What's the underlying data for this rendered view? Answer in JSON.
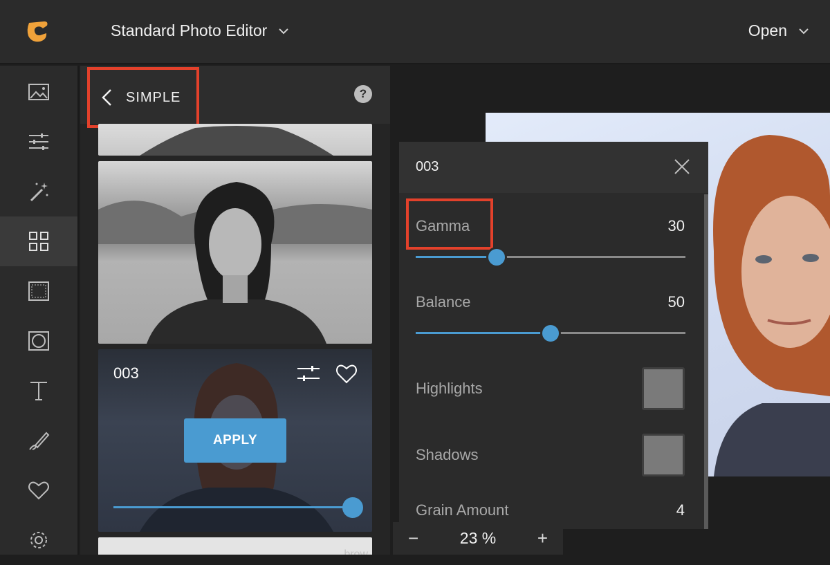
{
  "header": {
    "app_title": "Standard Photo Editor",
    "open_label": "Open"
  },
  "toolbar": {
    "items": [
      {
        "name": "image",
        "icon": "image-icon"
      },
      {
        "name": "adjust",
        "icon": "sliders-icon"
      },
      {
        "name": "effects",
        "icon": "magic-wand-icon"
      },
      {
        "name": "presets",
        "icon": "grid-icon",
        "active": true
      },
      {
        "name": "frames",
        "icon": "frame-icon"
      },
      {
        "name": "vignette",
        "icon": "vignette-icon"
      },
      {
        "name": "text",
        "icon": "text-icon"
      },
      {
        "name": "draw",
        "icon": "brush-icon"
      },
      {
        "name": "favorites",
        "icon": "heart-icon"
      },
      {
        "name": "settings",
        "icon": "gear-icon"
      }
    ]
  },
  "panel": {
    "back_label": "SIMPLE",
    "help_label": "?",
    "preset": {
      "name": "003",
      "apply_label": "APPLY",
      "strength": 1.0
    },
    "thumb_partial_label": "brow"
  },
  "adjustments": {
    "title": "003",
    "gamma": {
      "label": "Gamma",
      "value": "30",
      "fraction": 0.3
    },
    "balance": {
      "label": "Balance",
      "value": "50",
      "fraction": 0.5
    },
    "highlights": {
      "label": "Highlights"
    },
    "shadows": {
      "label": "Shadows"
    },
    "grain": {
      "label": "Grain Amount",
      "value": "4"
    }
  },
  "zoom": {
    "minus": "−",
    "value": "23 %",
    "plus": "+"
  },
  "colors": {
    "accent": "#4a9bd1",
    "highlight_box": "#e3412b",
    "logo": "#f0a23a"
  }
}
